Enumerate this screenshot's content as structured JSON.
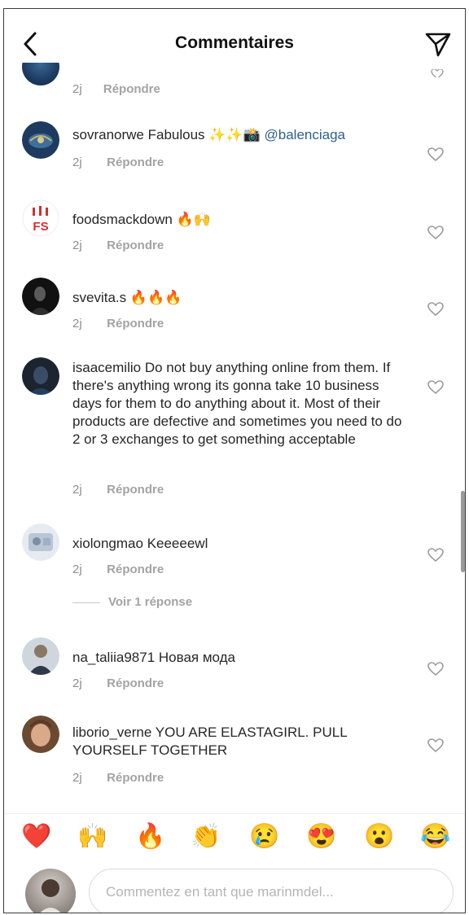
{
  "header": {
    "title": "Commentaires",
    "back_icon": "chevron-left-icon",
    "send_icon": "paper-plane-icon"
  },
  "partial_comment": {
    "time": "2j",
    "reply": "Répondre"
  },
  "comments": [
    {
      "user": "sovranorwe",
      "text": "Fabulous ✨✨📸",
      "mention": "@balenciaga",
      "time": "2j",
      "reply": "Répondre"
    },
    {
      "user": "foodsmackdown",
      "text": "🔥🙌",
      "time": "2j",
      "reply": "Répondre"
    },
    {
      "user": "svevita.s",
      "text": "🔥🔥🔥",
      "time": "2j",
      "reply": "Répondre"
    },
    {
      "user": "isaacemilio",
      "text": "Do not buy anything online from them. If there's anything wrong its gonna take 10 business days for them to do anything about it. Most of their products are defective and sometimes you need to do 2 or 3 exchanges to get something acceptable",
      "time": "2j",
      "reply": "Répondre"
    },
    {
      "user": "xiolongmao",
      "text": "Keeeeewl",
      "time": "2j",
      "reply": "Répondre"
    },
    {
      "user": "na_taliia9871",
      "text": "Новая мода",
      "time": "2j",
      "reply": "Répondre"
    },
    {
      "user": "liborio_verne",
      "text": "YOU ARE ELASTAGIRL. PULL YOURSELF TOGETHER",
      "time": "2j",
      "reply": "Répondre"
    }
  ],
  "view_replies": "Voir 1 réponse",
  "emoji_bar": [
    "❤️",
    "🙌",
    "🔥",
    "👏",
    "😢",
    "😍",
    "😮",
    "😂"
  ],
  "input": {
    "placeholder": "Commentez en tant que marinmdel..."
  },
  "colors": {
    "mention": "#2d5f8f",
    "meta": "#8e8e8e",
    "text": "#262626"
  }
}
